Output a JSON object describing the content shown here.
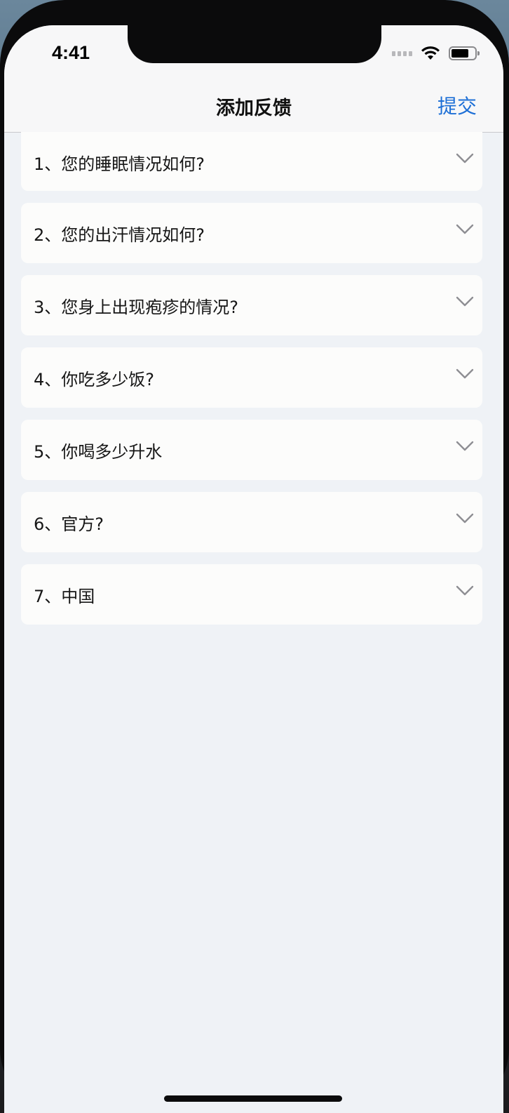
{
  "status_bar": {
    "time": "4:41"
  },
  "nav": {
    "title": "添加反馈",
    "submit_label": "提交"
  },
  "questions": [
    {
      "label": "1、您的睡眠情况如何?"
    },
    {
      "label": "2、您的出汗情况如何?"
    },
    {
      "label": "3、您身上出现疱疹的情况?"
    },
    {
      "label": "4、你吃多少饭?"
    },
    {
      "label": "5、你喝多少升水"
    },
    {
      "label": "6、官方?"
    },
    {
      "label": "7、中国"
    }
  ],
  "colors": {
    "accent": "#1d6fd6",
    "background": "#eff2f6",
    "card": "#fcfcfb"
  },
  "icons": {
    "wifi": "wifi-icon",
    "battery": "battery-icon",
    "chevron": "chevron-down-icon"
  }
}
